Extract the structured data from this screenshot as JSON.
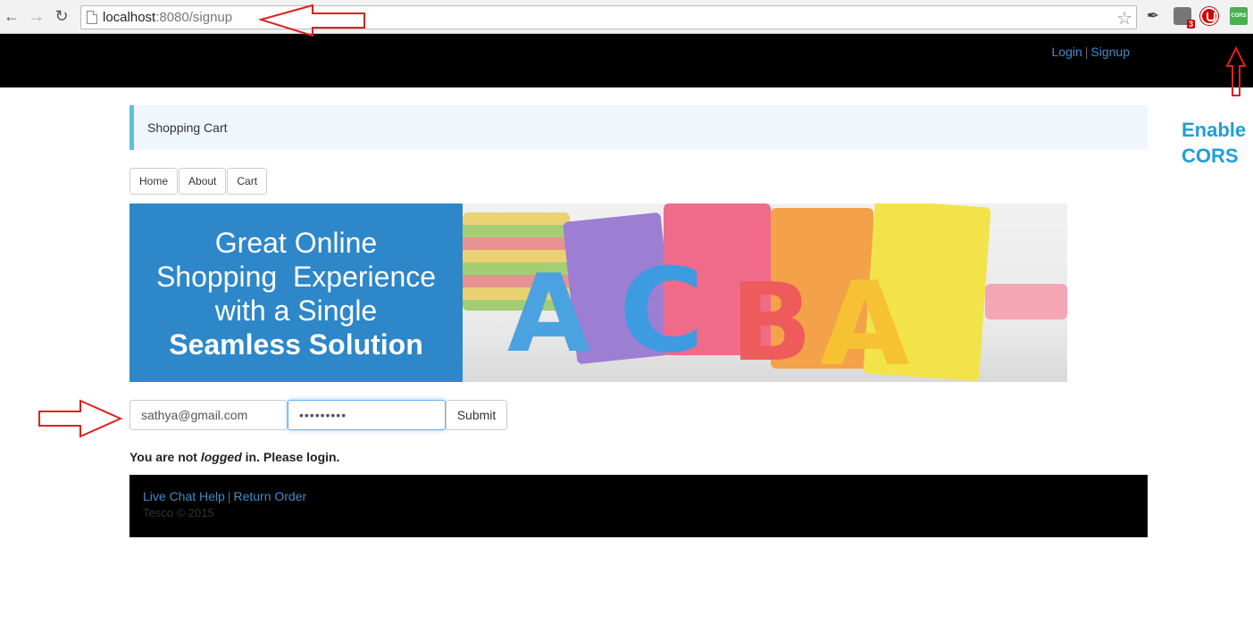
{
  "browser": {
    "url_host": "localhost",
    "url_rest": ":8080/signup",
    "extension_badge": "3",
    "cors_extension_label": "CORS"
  },
  "header": {
    "login": "Login",
    "separator": "|",
    "signup": "Signup"
  },
  "brand": {
    "title": "Shopping Cart"
  },
  "nav": {
    "home": "Home",
    "about": "About",
    "cart": "Cart"
  },
  "banner": {
    "line1": "Great Online",
    "line2": "Shopping  Experience",
    "line3": "with a Single",
    "line4": "Seamless Solution",
    "letters": [
      "A",
      "C",
      "B",
      "A"
    ]
  },
  "form": {
    "email_value": "sathya@gmail.com",
    "password_value": "•••••••••",
    "submit": "Submit"
  },
  "status": {
    "prefix": "You are not ",
    "emphasis": "logged",
    "suffix": " in. Please login."
  },
  "footer": {
    "live_chat": "Live Chat Help",
    "separator": "|",
    "return_order": "Return Order",
    "copyright": "Tesco © 2015"
  },
  "annotation": {
    "line1": "Enable",
    "line2": "CORS"
  },
  "colors": {
    "link": "#428bca",
    "banner_blue": "#2d87c8",
    "annotation": "#1e9fd8",
    "arrow_red": "#e02020"
  }
}
